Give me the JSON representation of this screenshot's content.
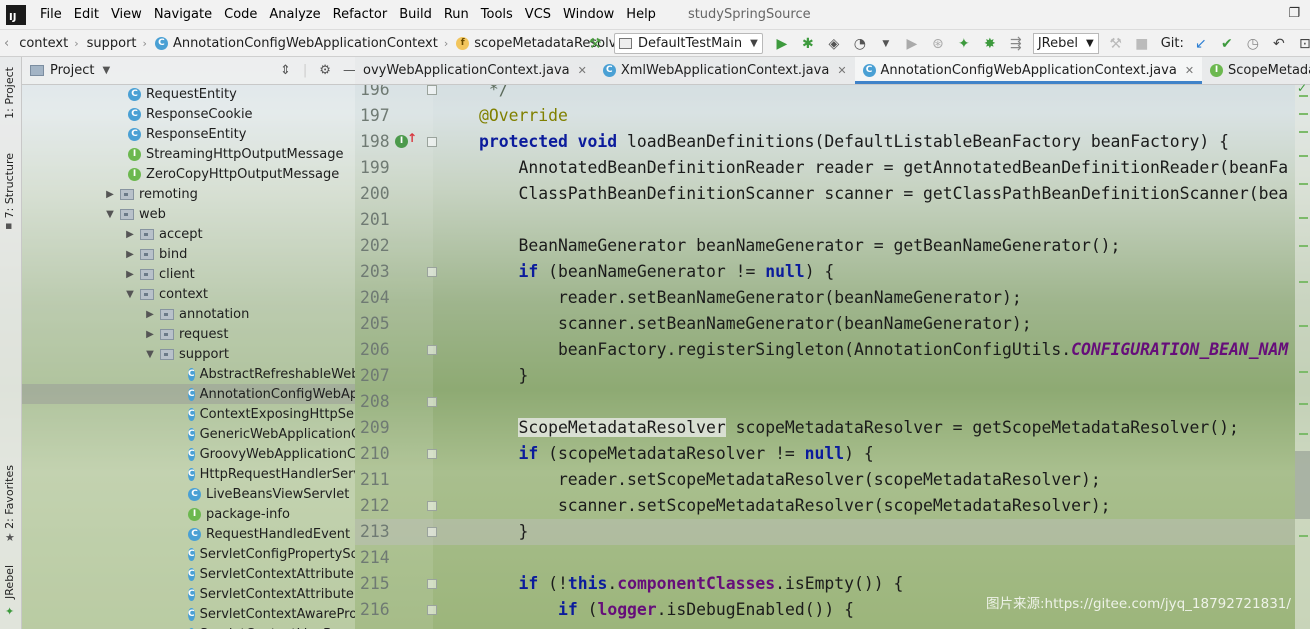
{
  "menubar": {
    "items": [
      {
        "label": "File"
      },
      {
        "label": "Edit"
      },
      {
        "label": "View"
      },
      {
        "label": "Navigate"
      },
      {
        "label": "Code"
      },
      {
        "label": "Analyze"
      },
      {
        "label": "Refactor"
      },
      {
        "label": "Build"
      },
      {
        "label": "Run"
      },
      {
        "label": "Tools"
      },
      {
        "label": "VCS"
      },
      {
        "label": "Window"
      },
      {
        "label": "Help"
      }
    ],
    "project_name": "studySpringSource",
    "restore_icon": "restore-window-icon"
  },
  "navbar": {
    "crumbs": [
      "context",
      "support",
      "AnnotationConfigWebApplicationContext",
      "scopeMetadataResolver"
    ],
    "run_config": "DefaultTestMain",
    "jrebel": "JRebel",
    "git_label": "Git:"
  },
  "left_stripe": {
    "project": "1: Project",
    "structure": "7: Structure",
    "favorites": "2: Favorites",
    "jrebel": "JRebel"
  },
  "project_panel": {
    "title": "Project",
    "tree": [
      {
        "label": "RequestEntity",
        "type": "class",
        "indent": 2
      },
      {
        "label": "ResponseCookie",
        "type": "class",
        "indent": 2
      },
      {
        "label": "ResponseEntity",
        "type": "class",
        "indent": 2
      },
      {
        "label": "StreamingHttpOutputMessage",
        "type": "interface",
        "indent": 2
      },
      {
        "label": "ZeroCopyHttpOutputMessage",
        "type": "interface",
        "indent": 2
      },
      {
        "label": "remoting",
        "type": "package",
        "indent": 1,
        "arrow": "▶"
      },
      {
        "label": "web",
        "type": "package",
        "indent": 1,
        "arrow": "▼"
      },
      {
        "label": "accept",
        "type": "package",
        "indent": 2,
        "arrow": "▶"
      },
      {
        "label": "bind",
        "type": "package",
        "indent": 2,
        "arrow": "▶"
      },
      {
        "label": "client",
        "type": "package",
        "indent": 2,
        "arrow": "▶"
      },
      {
        "label": "context",
        "type": "package",
        "indent": 2,
        "arrow": "▼"
      },
      {
        "label": "annotation",
        "type": "package",
        "indent": 3,
        "arrow": "▶"
      },
      {
        "label": "request",
        "type": "package",
        "indent": 3,
        "arrow": "▶"
      },
      {
        "label": "support",
        "type": "package",
        "indent": 3,
        "arrow": "▼"
      },
      {
        "label": "AbstractRefreshableWebA",
        "type": "class",
        "indent": 4
      },
      {
        "label": "AnnotationConfigWebApp",
        "type": "class",
        "indent": 4,
        "selected": true
      },
      {
        "label": "ContextExposingHttpServle",
        "type": "class",
        "indent": 4
      },
      {
        "label": "GenericWebApplicationCo",
        "type": "class",
        "indent": 4
      },
      {
        "label": "GroovyWebApplicationCor",
        "type": "class",
        "indent": 4
      },
      {
        "label": "HttpRequestHandlerServle",
        "type": "class",
        "indent": 4
      },
      {
        "label": "LiveBeansViewServlet",
        "type": "class",
        "indent": 4
      },
      {
        "label": "package-info",
        "type": "interface",
        "indent": 4
      },
      {
        "label": "RequestHandledEvent",
        "type": "class",
        "indent": 4
      },
      {
        "label": "ServletConfigPropertySour",
        "type": "class",
        "indent": 4
      },
      {
        "label": "ServletContextAttributeExp",
        "type": "class",
        "indent": 4
      },
      {
        "label": "ServletContextAttributeFac",
        "type": "class",
        "indent": 4
      },
      {
        "label": "ServletContextAwareProce",
        "type": "class",
        "indent": 4
      },
      {
        "label": "ServletContextLiveBeansVi",
        "type": "class",
        "indent": 4
      }
    ]
  },
  "tabs": [
    {
      "label": "ovyWebApplicationContext.java",
      "active": false
    },
    {
      "label": "XmlWebApplicationContext.java",
      "active": false
    },
    {
      "label": "AnnotationConfigWebApplicationContext.java",
      "active": true
    },
    {
      "label": "ScopeMetadataResolver.java",
      "active": false
    }
  ],
  "editor": {
    "lines": [
      {
        "n": "196",
        "html": "<span class=\"comment\"> */</span>"
      },
      {
        "n": "197",
        "html": "<span class=\"ann\">@Override</span>"
      },
      {
        "n": "198",
        "html": "<span class=\"kw\">protected void</span> loadBeanDefinitions(DefaultListableBeanFactory beanFactory) {",
        "marker": true
      },
      {
        "n": "199",
        "html": "    AnnotatedBeanDefinitionReader reader = getAnnotatedBeanDefinitionReader(beanFa"
      },
      {
        "n": "200",
        "html": "    ClassPathBeanDefinitionScanner scanner = getClassPathBeanDefinitionScanner(bea"
      },
      {
        "n": "201",
        "html": ""
      },
      {
        "n": "202",
        "html": "    BeanNameGenerator beanNameGenerator = getBeanNameGenerator();"
      },
      {
        "n": "203",
        "html": "    <span class=\"kw\">if</span> (beanNameGenerator != <span class=\"kw\">null</span>) {"
      },
      {
        "n": "204",
        "html": "        reader.setBeanNameGenerator(beanNameGenerator);"
      },
      {
        "n": "205",
        "html": "        scanner.setBeanNameGenerator(beanNameGenerator);"
      },
      {
        "n": "206",
        "html": "        beanFactory.registerSingleton(AnnotationConfigUtils.<span class=\"static-f\">CONFIGURATION_BEAN_NAM</span>"
      },
      {
        "n": "207",
        "html": "    }"
      },
      {
        "n": "208",
        "html": ""
      },
      {
        "n": "209",
        "html": "    <span class=\"hl\">ScopeMetadataResolver</span> scopeMetadataResolver = getScopeMetadataResolver();"
      },
      {
        "n": "210",
        "html": "    <span class=\"kw\">if</span> (scopeMetadataResolver != <span class=\"kw\">null</span>) {"
      },
      {
        "n": "211",
        "html": "        reader.setScopeMetadataResolver(scopeMetadataResolver);"
      },
      {
        "n": "212",
        "html": "        scanner.setScopeMetadataResolver(scopeMetadataResolver);"
      },
      {
        "n": "213",
        "html": "    }",
        "current": true
      },
      {
        "n": "214",
        "html": ""
      },
      {
        "n": "215",
        "html": "    <span class=\"kw\">if</span> (!<span class=\"kw\">this</span>.<span class=\"field\">componentClasses</span>.isEmpty()) {"
      },
      {
        "n": "216",
        "html": "        <span class=\"kw\">if</span> (<span class=\"field\">logger</span>.isDebugEnabled()) {"
      }
    ]
  },
  "watermark": "图片来源:https://gitee.com/jyq_18792721831/"
}
